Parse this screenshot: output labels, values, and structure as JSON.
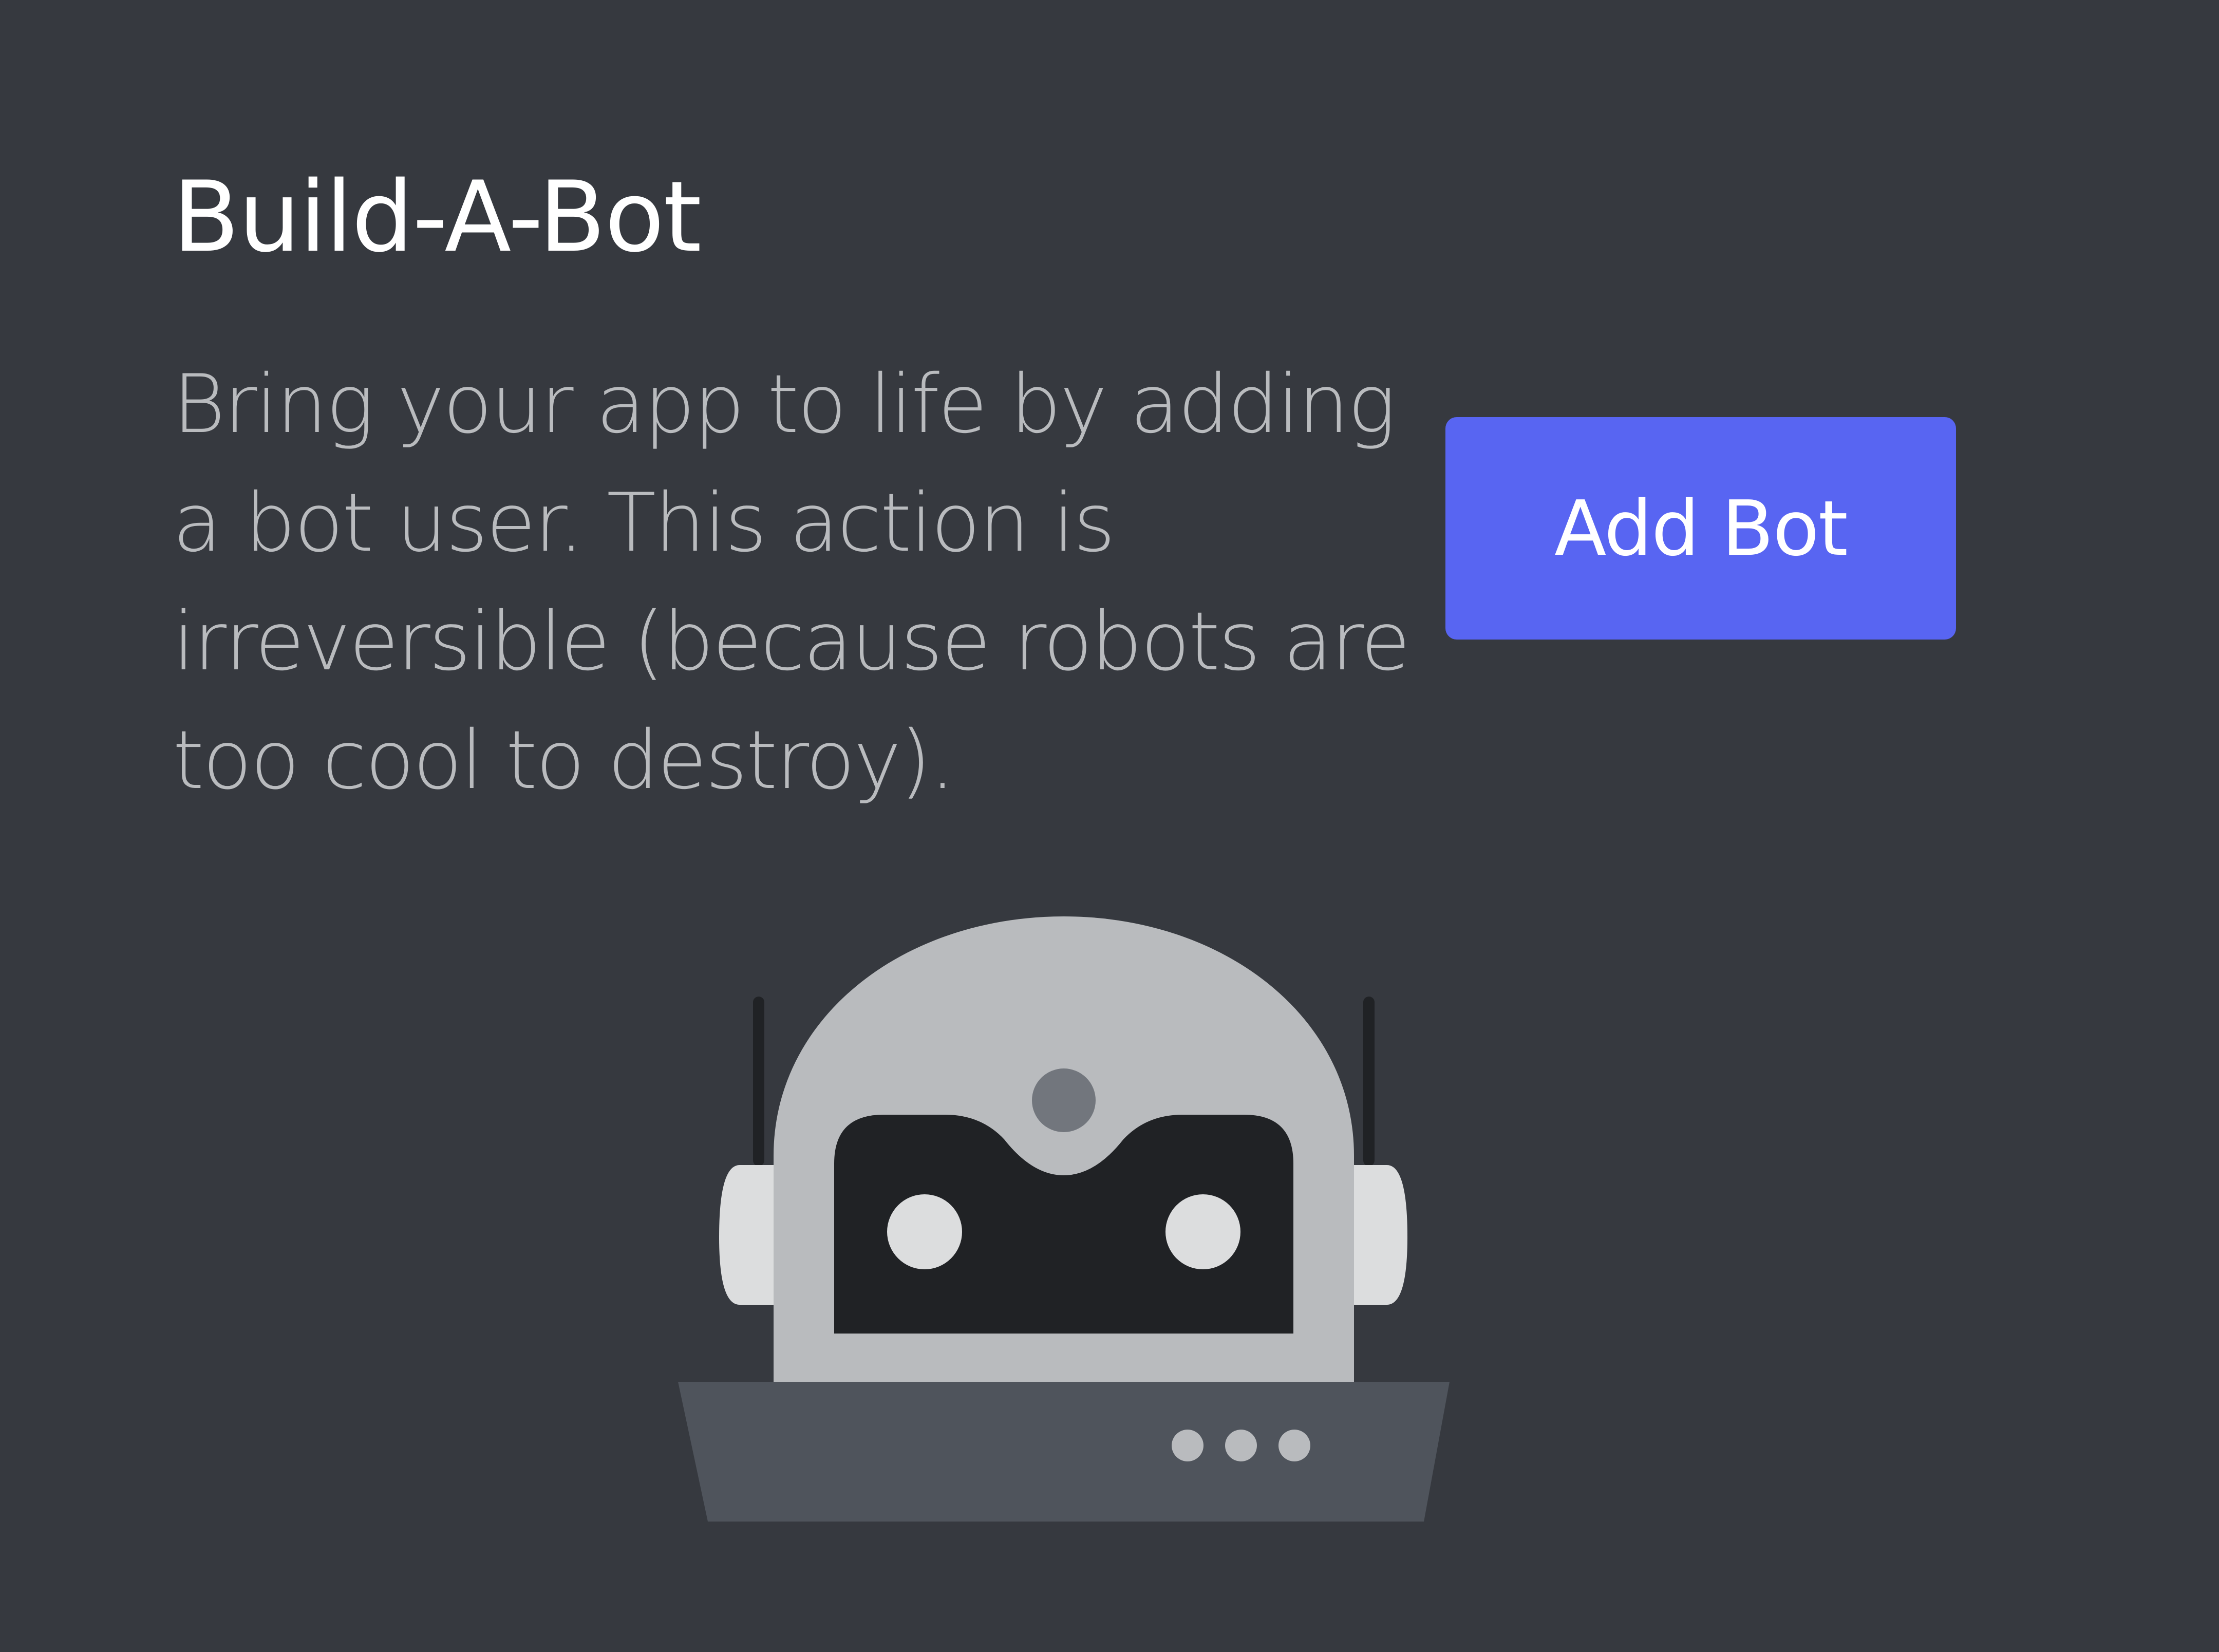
{
  "section": {
    "title": "Build-A-Bot",
    "description": "Bring your app to life by adding a bot user. This action is irreversible (because robots are too cool to destroy).",
    "add_bot_label": "Add Bot"
  },
  "illustration": {
    "icon": "robot-illustration",
    "status_dots": 3
  },
  "colors": {
    "background": "#36393f",
    "title": "#ffffff",
    "description": "#b9bbbe",
    "button": "#5865f2",
    "robot_head": "#b9bbbe",
    "robot_face": "#202225",
    "robot_base": "#4f545c",
    "robot_eyes": "#dcddde"
  }
}
